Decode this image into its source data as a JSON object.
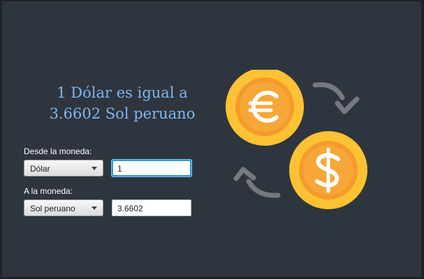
{
  "header": {
    "title_line1": "1 Dólar es igual a",
    "title_line2": "3.6602 Sol peruano"
  },
  "form": {
    "from_label": "Desde la moneda:",
    "from_currency": "Dólar",
    "from_amount": "1",
    "to_label": "A la moneda:",
    "to_currency": "Sol peruano",
    "to_amount": "3.6602"
  },
  "colors": {
    "background": "#2f353e",
    "title": "#7fb6ef",
    "coin_gold": "#fdc233",
    "coin_orange": "#f59a2c",
    "arrow_gray": "#767a80",
    "focus_border": "#2b9ad8"
  },
  "icons": {
    "euro_coin": "euro-coin-icon",
    "dollar_coin": "dollar-coin-icon",
    "exchange_arrows": "exchange-arrows-icon"
  }
}
